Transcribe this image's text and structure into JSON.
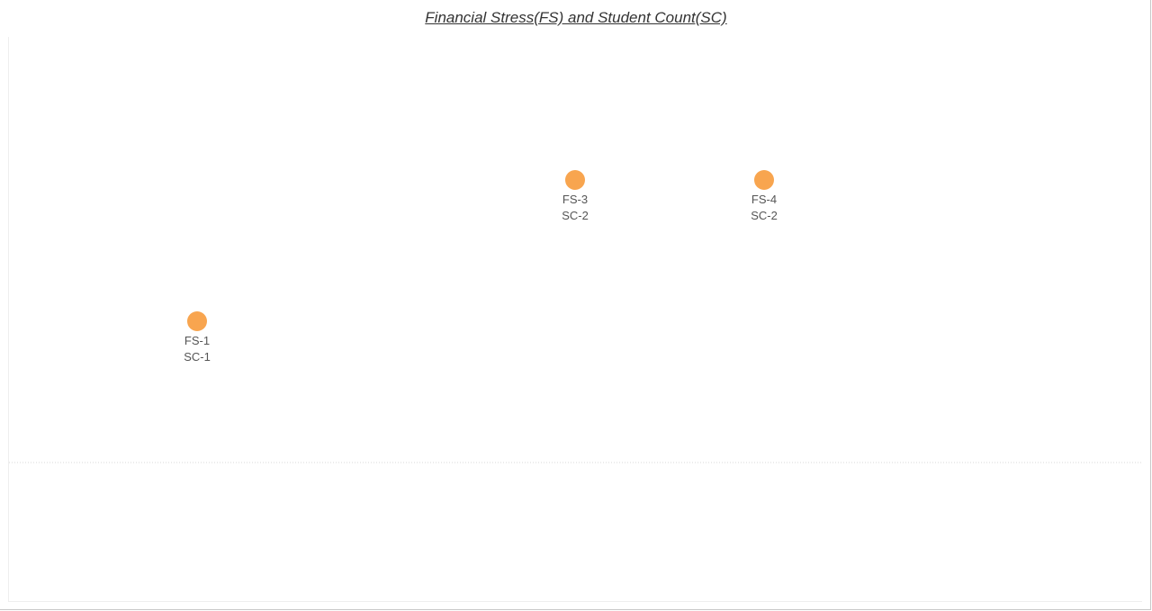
{
  "chart_data": {
    "type": "scatter",
    "title": "Financial Stress(FS) and Student Count(SC)",
    "xlabel": "",
    "ylabel": "",
    "x": [
      1,
      3,
      4
    ],
    "y": [
      1,
      2,
      2
    ],
    "labels": [
      {
        "fs": "FS-1",
        "sc": "SC-1"
      },
      {
        "fs": "FS-3",
        "sc": "SC-2"
      },
      {
        "fs": "FS-4",
        "sc": "SC-2"
      }
    ],
    "xlim": [
      0.5,
      5.5
    ],
    "ylim": [
      0,
      3
    ],
    "grid": false,
    "zero_line": true,
    "marker_color": "#F8A54F"
  }
}
